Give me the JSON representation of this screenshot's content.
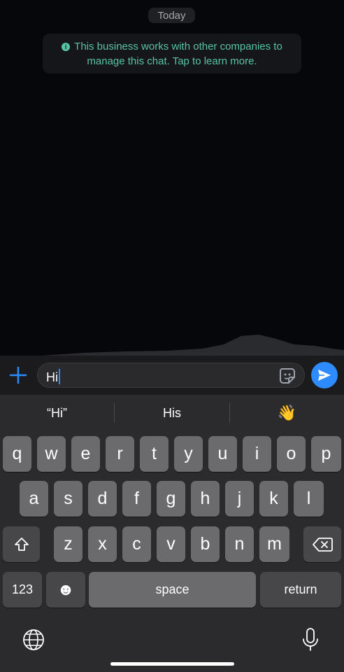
{
  "chat": {
    "date_label": "Today",
    "notice_text": "This business works with other companies to manage this chat. Tap to learn more."
  },
  "composer": {
    "input_value": "Hi"
  },
  "keyboard": {
    "suggestions": [
      "“Hi”",
      "His",
      "👋"
    ],
    "row1": [
      "q",
      "w",
      "e",
      "r",
      "t",
      "y",
      "u",
      "i",
      "o",
      "p"
    ],
    "row2": [
      "a",
      "s",
      "d",
      "f",
      "g",
      "h",
      "j",
      "k",
      "l"
    ],
    "row3": [
      "z",
      "x",
      "c",
      "v",
      "b",
      "n",
      "m"
    ],
    "numbers_label": "123",
    "emoji_label": "☻",
    "space_label": "space",
    "return_label": "return"
  },
  "colors": {
    "accent": "#2e8bff",
    "notice_text": "#59c2a5"
  }
}
